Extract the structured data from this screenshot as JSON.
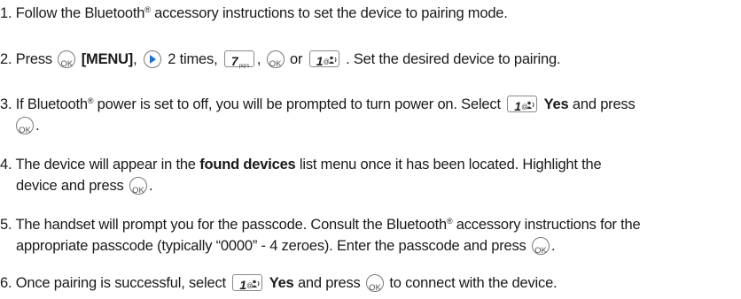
{
  "steps": [
    {
      "num": "1.",
      "text_a": "Follow the Bluetooth",
      "reg": "®",
      "text_b": "accessory instructions to set the device to pairing mode."
    },
    {
      "num": "2.",
      "text_a": "Press",
      "menu": "[MENU]",
      "comma1": ",",
      "times": "2 times,",
      "comma2": ",",
      "or": "or",
      "text_b": ". Set the desired device to pairing."
    },
    {
      "num": "3.",
      "text_a": "If Bluetooth",
      "reg": "®",
      "text_b": "power is set to off, you will be prompted to turn power on. Select",
      "yes": "Yes",
      "text_c": "and press",
      "text_d": "."
    },
    {
      "num": "4.",
      "text_a": "The device will appear in the",
      "found": "found devices",
      "text_b": "list menu once it has been located. Highlight the",
      "text_c": "device and press",
      "text_d": "."
    },
    {
      "num": "5.",
      "text_a": "The handset will prompt you for the passcode. Consult the Bluetooth",
      "reg": "®",
      "text_b": "accessory instructions for the",
      "text_c": "appropriate passcode (typically “0000” - 4 zeroes). Enter the passcode and press",
      "text_d": "."
    },
    {
      "num": "6.",
      "text_a": "Once pairing is successful, select",
      "yes": "Yes",
      "text_b": "and press",
      "text_c": "to connect with the device."
    }
  ],
  "keys": {
    "ok_label": "OK",
    "key7_num": "7",
    "key7_letters": "pqrs",
    "key1_num": "1"
  },
  "colors": {
    "text": "#1a1a1a",
    "key_border": "#7a7a7a",
    "nav_triangle": "#1a6fd6"
  }
}
